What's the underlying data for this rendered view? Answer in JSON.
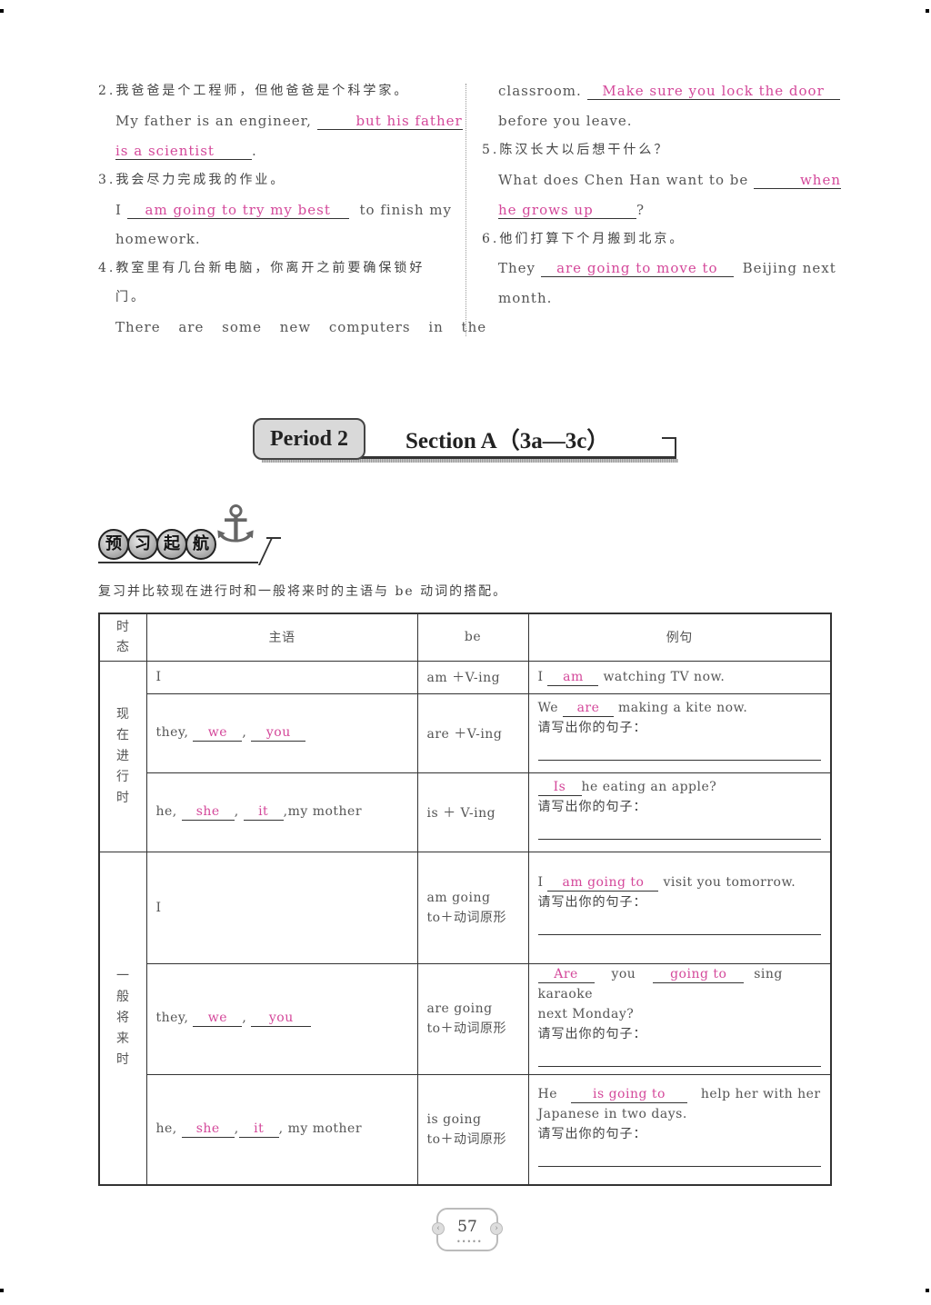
{
  "exercises_left": [
    {
      "num": "2.",
      "cn": "我爸爸是个工程师，但他爸爸是个科学家。",
      "en_prefix": "My father is an engineer,",
      "answer_part1": "but his father",
      "answer_part2": "is a scientist",
      "en_suffix": "."
    },
    {
      "num": "3.",
      "cn": "我会尽力完成我的作业。",
      "en_prefix": "I",
      "answer": "am going to try my best",
      "en_suffix": "to finish my",
      "en_line2": "homework."
    },
    {
      "num": "4.",
      "cn": "教室里有几台新电脑，你离开之前要确保锁好",
      "cn_line2": "门。",
      "en_line1": "There are some new computers in the"
    }
  ],
  "exercises_right": [
    {
      "en_prefix": "classroom.",
      "answer": "Make sure you lock the door",
      "en_line2": "before you leave."
    },
    {
      "num": "5.",
      "cn": "陈汉长大以后想干什么？",
      "en_prefix": "What does Chen Han want to be",
      "answer_part1": "when",
      "answer_part2": "he grows up",
      "en_suffix": "?"
    },
    {
      "num": "6.",
      "cn": "他们打算下个月搬到北京。",
      "en_prefix": "They",
      "answer": "are going to move to",
      "en_suffix": "Beijing next",
      "en_line2": "month."
    }
  ],
  "period_banner": {
    "badge": "Period 2",
    "title": "Section A（3a—3c）"
  },
  "preview_banner": {
    "chars": [
      "预",
      "习",
      "起",
      "航"
    ],
    "icon": "anchor-icon"
  },
  "instruction": "复习并比较现在进行时和一般将来时的主语与 be 动词的搭配。",
  "table": {
    "headers": [
      "时态",
      "主语",
      "be",
      "例句"
    ],
    "groups": [
      {
        "tense": [
          "现",
          "在",
          "进",
          "行",
          "时"
        ],
        "rows": [
          {
            "subject_prefix": "I",
            "subject_answers": [],
            "be": "am ＋V-ing",
            "example": {
              "pre": "I",
              "answer": "am",
              "post": "watching TV now."
            },
            "write_prompt": ""
          },
          {
            "subject_prefix": "they,",
            "subject_answers": [
              "we",
              "you"
            ],
            "subject_suffix": "",
            "be": "are ＋V-ing",
            "example": {
              "pre": "We",
              "answer": "are",
              "post": "making a kite now."
            },
            "write_prompt": "请写出你的句子："
          },
          {
            "subject_prefix": "he,",
            "subject_answers": [
              "she",
              "it"
            ],
            "subject_suffix": ",my mother",
            "be": "is ＋ V-ing",
            "example": {
              "pre": "",
              "answer": "Is",
              "post": "he eating an apple?"
            },
            "write_prompt": "请写出你的句子："
          }
        ]
      },
      {
        "tense": [
          "一",
          "般",
          "将",
          "来",
          "时"
        ],
        "rows": [
          {
            "subject_prefix": "I",
            "subject_answers": [],
            "be_line1": "am going",
            "be_line2": "to＋动词原形",
            "example": {
              "pre": "I",
              "answer": "am going to",
              "post": "visit you tomorrow."
            },
            "write_prompt": "请写出你的句子："
          },
          {
            "subject_prefix": "they,",
            "subject_answers": [
              "we",
              "you"
            ],
            "be_line1": "are going",
            "be_line2": "to＋动词原形",
            "example": {
              "pre": "",
              "answer": "Are",
              "mid": "you",
              "answer2": "going to",
              "post": "sing karaoke",
              "line2": "next Monday?"
            },
            "write_prompt": "请写出你的句子："
          },
          {
            "subject_prefix": "he,",
            "subject_answers": [
              "she",
              "it"
            ],
            "subject_suffix": ", my mother",
            "be_line1": "is going",
            "be_line2": "to＋动词原形",
            "example": {
              "pre": "He",
              "answer": "is going to",
              "post": "help her with her",
              "line2": "Japanese in two days."
            },
            "write_prompt": "请写出你的句子："
          }
        ]
      }
    ]
  },
  "page_number": "57",
  "colors": {
    "answer": "#d4489a",
    "text": "#555555",
    "rule": "#333333"
  }
}
